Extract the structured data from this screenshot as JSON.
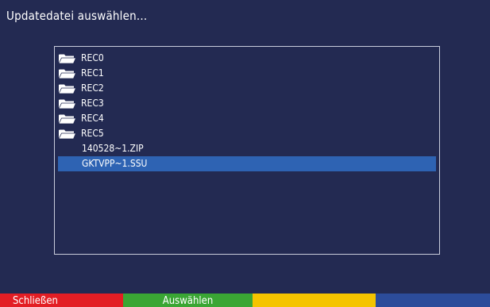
{
  "title": "Updatedatei auswählen...",
  "file_list": {
    "items": [
      {
        "type": "folder",
        "label": "REC0",
        "icon": "folder-icon"
      },
      {
        "type": "folder",
        "label": "REC1",
        "icon": "folder-icon"
      },
      {
        "type": "folder",
        "label": "REC2",
        "icon": "folder-icon"
      },
      {
        "type": "folder",
        "label": "REC3",
        "icon": "folder-icon"
      },
      {
        "type": "folder",
        "label": "REC4",
        "icon": "folder-icon"
      },
      {
        "type": "folder",
        "label": "REC5",
        "icon": "folder-icon"
      },
      {
        "type": "file",
        "label": "140528~1.ZIP"
      },
      {
        "type": "file",
        "label": "GKTVPP~1.SSU",
        "selected": true
      }
    ]
  },
  "color_keys": {
    "red": {
      "label": "Schließen",
      "color": "#e31e24"
    },
    "green": {
      "label": "Auswählen",
      "color": "#3aa634"
    },
    "yellow": {
      "label": "",
      "color": "#f5c400"
    },
    "blue": {
      "label": "",
      "color": "#2c4c9a"
    }
  },
  "colors": {
    "background": "#232a52",
    "selection": "#2e63b3",
    "panel_border": "#c9cddc"
  }
}
